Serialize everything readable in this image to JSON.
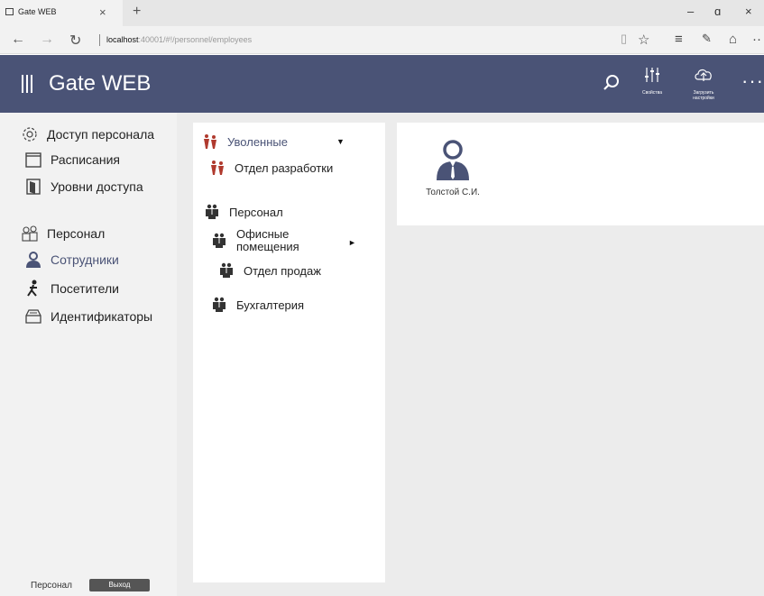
{
  "browser": {
    "tab_title": "Gate WEB",
    "tab_close": "×",
    "new_tab": "+",
    "minimize": "–",
    "restore": "ɑ",
    "close": "×",
    "url_host": "localhost",
    "url_path": ":40001/#!/personnel/employees",
    "icons": [
      "reading-view-icon",
      "favorite-star-icon",
      "hub-icon",
      "web-note-icon",
      "share-icon",
      "more-icon"
    ]
  },
  "header": {
    "title": "Gate WEB",
    "properties_label": "Свойства",
    "upload_label": "Загрузить настройки",
    "more": "···"
  },
  "sidebar": {
    "items": [
      {
        "label": "Доступ персонала",
        "icon": "gear-icon"
      },
      {
        "label": "Расписания",
        "icon": "calendar-icon"
      },
      {
        "label": "Уровни доступа",
        "icon": "door-icon"
      },
      {
        "label": "Персонал",
        "icon": "people-icon"
      },
      {
        "label": "Сотрудники",
        "icon": "employee-icon"
      },
      {
        "label": "Посетители",
        "icon": "visitor-icon"
      },
      {
        "label": "Идентификаторы",
        "icon": "card-box-icon"
      }
    ],
    "footer_label": "Персонал",
    "logout_label": "Выход"
  },
  "tree": {
    "items": [
      {
        "label": "Уволенные"
      },
      {
        "label": "Отдел разработки"
      },
      {
        "label": "Персонал"
      },
      {
        "label": "Офисные помещения"
      },
      {
        "label": "Отдел продаж"
      },
      {
        "label": "Бухгалтерия"
      }
    ],
    "arrow_down": "▼",
    "arrow_right": "►"
  },
  "employees": [
    {
      "name": "Толстой С.И."
    }
  ],
  "colors": {
    "header_bg": "#4a5376",
    "accent": "#4a5376",
    "dismissed_icon": "#b03a2e"
  }
}
